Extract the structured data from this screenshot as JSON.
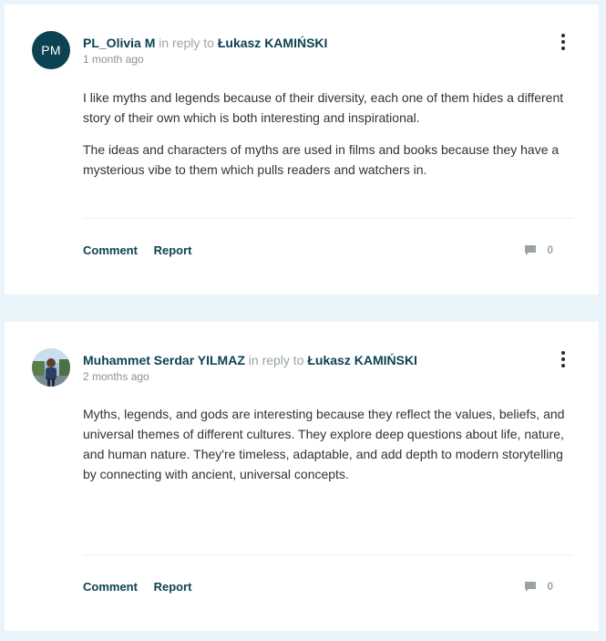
{
  "comments": [
    {
      "avatar_initials": "PM",
      "author": "PL_Olivia M",
      "in_reply_to_text": "in reply to",
      "reply_target": "Łukasz KAMIŃSKI",
      "time": "1 month ago",
      "paragraphs": [
        "I like myths and legends because of their diversity, each one of them hides a different story of their own which is both interesting and inspirational.",
        "The ideas and characters of myths are used in films and books because they have a mysterious vibe to them which pulls readers and watchers in."
      ],
      "comment_label": "Comment",
      "report_label": "Report",
      "reply_count": "0"
    },
    {
      "avatar_icon": "user-photo",
      "author": "Muhammet Serdar YILMAZ",
      "in_reply_to_text": "in reply to",
      "reply_target": "Łukasz KAMIŃSKI",
      "time": "2 months ago",
      "paragraphs": [
        "Myths, legends, and gods are interesting because they reflect the values, beliefs, and universal themes of different cultures. They explore deep questions about life, nature, and human nature. They're timeless, adaptable, and add depth to modern storytelling by connecting with ancient, universal concepts."
      ],
      "comment_label": "Comment",
      "report_label": "Report",
      "reply_count": "0"
    }
  ],
  "colors": {
    "page_bg": "#eaf5fb",
    "accent": "#0d4253",
    "muted": "#9aa3a8"
  },
  "icons": {
    "menu": "kebab-menu-icon",
    "replies": "speech-bubble-icon"
  }
}
